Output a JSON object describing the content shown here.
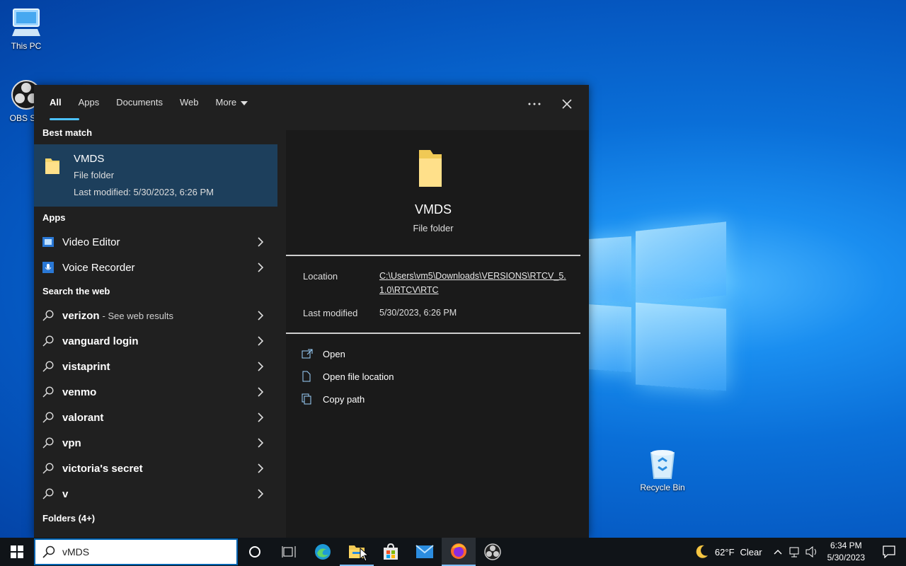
{
  "desktop": {
    "icons": [
      {
        "label": "This PC",
        "icon": "computer-icon"
      },
      {
        "label": "OBS Stu",
        "icon": "obs-icon"
      },
      {
        "label": "Recycle Bin",
        "icon": "recycle-bin-icon"
      }
    ]
  },
  "search_panel": {
    "tabs": [
      "All",
      "Apps",
      "Documents",
      "Web",
      "More"
    ],
    "active_tab": "All",
    "best_match": {
      "header": "Best match",
      "name": "VMDS",
      "type": "File folder",
      "modified": "Last modified: 5/30/2023, 6:26 PM"
    },
    "apps_header": "Apps",
    "apps": [
      "Video Editor",
      "Voice Recorder"
    ],
    "web_header": "Search the web",
    "web_results": [
      {
        "term": "verizon",
        "suffix": "- See web results"
      },
      {
        "term": "vanguard login",
        "suffix": ""
      },
      {
        "term": "vistaprint",
        "suffix": ""
      },
      {
        "term": "venmo",
        "suffix": ""
      },
      {
        "term": "valorant",
        "suffix": ""
      },
      {
        "term": "vpn",
        "suffix": ""
      },
      {
        "term": "victoria's secret",
        "suffix": ""
      },
      {
        "term": "v",
        "suffix": ""
      }
    ],
    "folders_header": "Folders (4+)",
    "preview": {
      "name": "VMDS",
      "type": "File folder",
      "location_label": "Location",
      "location_value": "C:\\Users\\vm5\\Downloads\\VERSIONS\\RTCV_5.1.0\\RTCV\\RTC",
      "modified_label": "Last modified",
      "modified_value": "5/30/2023, 6:26 PM",
      "actions": [
        "Open",
        "Open file location",
        "Copy path"
      ]
    }
  },
  "taskbar": {
    "search_value": "vMDS",
    "weather": {
      "temp": "62°F",
      "condition": "Clear"
    },
    "time": "6:34 PM",
    "date": "5/30/2023"
  }
}
